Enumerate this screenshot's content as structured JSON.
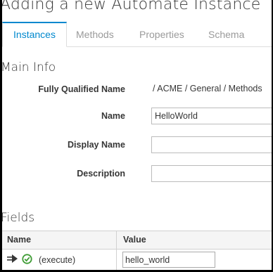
{
  "page": {
    "title": "Adding a new Automate Instance"
  },
  "tabs": [
    {
      "label": "Instances",
      "active": true
    },
    {
      "label": "Methods",
      "active": false
    },
    {
      "label": "Properties",
      "active": false
    },
    {
      "label": "Schema",
      "active": false
    }
  ],
  "main_info": {
    "title": "Main Info",
    "fqn_label": "Fully Qualified Name",
    "fqn_value": "/ ACME / General / Methods",
    "name_label": "Name",
    "name_value": "HelloWorld",
    "display_name_label": "Display Name",
    "display_name_value": "",
    "description_label": "Description",
    "description_value": ""
  },
  "fields": {
    "title": "Fields",
    "columns": {
      "name": "Name",
      "value": "Value"
    },
    "rows": [
      {
        "icons": [
          "method-icon",
          "check-circle-icon"
        ],
        "name": "(execute)",
        "value": "hello_world"
      }
    ]
  },
  "colors": {
    "accent": "#0088ce",
    "success": "#3f9c35",
    "text": "#363636"
  }
}
